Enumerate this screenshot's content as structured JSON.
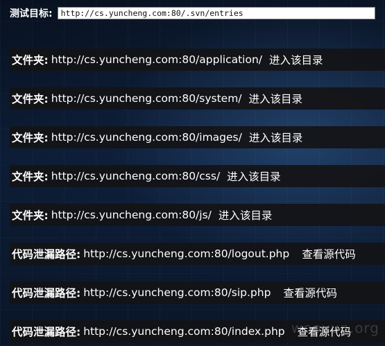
{
  "target": {
    "label": "测试目标:",
    "value": "http://cs.yuncheng.com:80/.svn/entries"
  },
  "results": [
    {
      "prefix": "文件夹:",
      "url": "http://cs.yuncheng.com:80/application/",
      "action": "进入该目录"
    },
    {
      "prefix": "文件夹:",
      "url": "http://cs.yuncheng.com:80/system/",
      "action": "进入该目录"
    },
    {
      "prefix": "文件夹:",
      "url": "http://cs.yuncheng.com:80/images/",
      "action": "进入该目录"
    },
    {
      "prefix": "文件夹:",
      "url": "http://cs.yuncheng.com:80/css/",
      "action": "进入该目录"
    },
    {
      "prefix": "文件夹:",
      "url": "http://cs.yuncheng.com:80/js/",
      "action": "进入该目录"
    },
    {
      "prefix": "代码泄漏路径:",
      "url": "http://cs.yuncheng.com:80/logout.php",
      "action": "查看源代码"
    },
    {
      "prefix": "代码泄漏路径:",
      "url": "http://cs.yuncheng.com:80/sip.php",
      "action": "查看源代码"
    },
    {
      "prefix": "代码泄漏路径:",
      "url": "http://cs.yuncheng.com:80/index.php",
      "action": "查看源代码"
    }
  ],
  "watermark": "wooyun.org"
}
